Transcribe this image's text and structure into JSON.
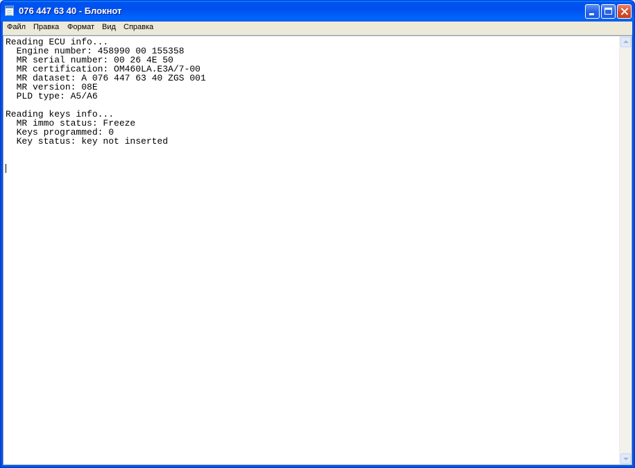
{
  "window": {
    "title": "076 447 63 40 - Блокнот",
    "icon": "notepad-icon"
  },
  "title_buttons": {
    "minimize_icon": "minimize-icon",
    "maximize_icon": "maximize-icon",
    "close_icon": "close-icon"
  },
  "menu": {
    "items": [
      {
        "label": "Файл"
      },
      {
        "label": "Правка"
      },
      {
        "label": "Формат"
      },
      {
        "label": "Вид"
      },
      {
        "label": "Справка"
      }
    ]
  },
  "document": {
    "content": "Reading ECU info...\n  Engine number: 458990 00 155358\n  MR serial number: 00 26 4E 50\n  MR certification: OM460LA.E3A/7-00\n  MR dataset: A 076 447 63 40 ZGS 001\n  MR version: 08E\n  PLD type: A5/A6\n\nReading keys info...\n  MR immo status: Freeze\n  Keys programmed: 0\n  Key status: key not inserted"
  },
  "scrollbar": {
    "up_icon": "scroll-up-arrow-icon",
    "down_icon": "scroll-down-arrow-icon"
  },
  "colors": {
    "titlebar": "#0054e3",
    "close_button": "#d6502c",
    "menubar": "#ece9d8",
    "editor_background": "#ffffff"
  }
}
